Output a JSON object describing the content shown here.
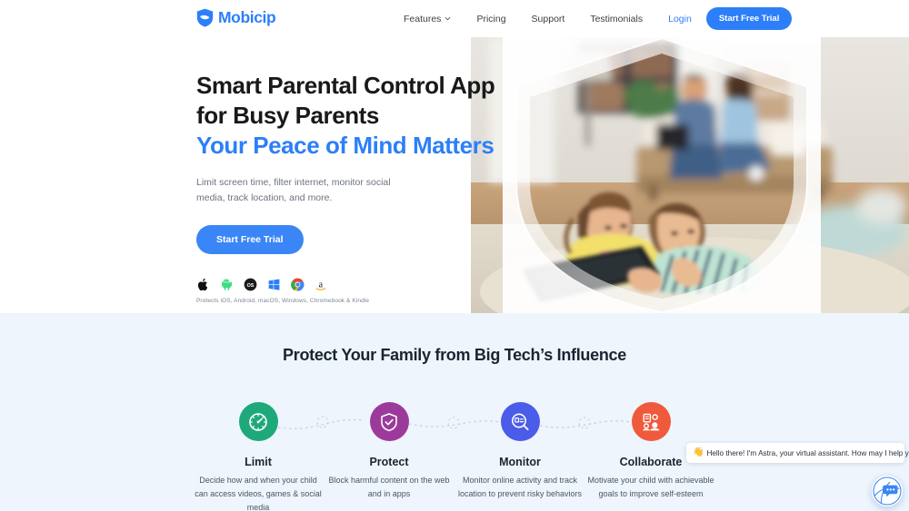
{
  "header": {
    "logo_text": "Mobicip",
    "logo_icon": "shield-logo-icon",
    "nav": [
      {
        "label": "Features",
        "has_caret": true,
        "icon": "chevron-down-icon"
      },
      {
        "label": "Pricing",
        "has_caret": false
      },
      {
        "label": "Support",
        "has_caret": false
      },
      {
        "label": "Testimonials",
        "has_caret": false
      }
    ],
    "login_label": "Login",
    "cta_label": "Start Free Trial",
    "accent_color": "#2D7FF9"
  },
  "hero": {
    "heading_line1": "Smart Parental Control App",
    "heading_line2": "for Busy Parents",
    "heading_accent": "Your Peace of Mind Matters",
    "subheading": "Limit screen time, filter internet, monitor social media, track location, and more.",
    "cta_label": "Start Free Trial",
    "cta_color": "#3b86f7",
    "platforms": [
      {
        "name": "apple-icon",
        "label": "Apple",
        "color": "#111111"
      },
      {
        "name": "android-icon",
        "label": "Android",
        "color": "#3DDC84"
      },
      {
        "name": "macos-icon",
        "label": "macOS",
        "color": "#1a1a1a"
      },
      {
        "name": "windows-icon",
        "label": "Windows",
        "color": "#2D7FF9"
      },
      {
        "name": "chrome-icon",
        "label": "Chromebook",
        "color": "#EA4335"
      },
      {
        "name": "amazon-icon",
        "label": "Kindle",
        "color": "#1a1a1a"
      }
    ],
    "platform_note": "Protects iOS, Android, macOS, Windows, Chromebook & Kindle",
    "image_alt": "Two children lying on carpet using a tablet while parents sit on a couch behind them, framed inside a translucent shield shape"
  },
  "features": {
    "title": "Protect Your Family from Big Tech’s Influence",
    "background_color": "#eef5fd",
    "items": [
      {
        "title": "Limit",
        "description": "Decide how and when your child can access videos, games & social media",
        "icon": "clock-icon",
        "color": "#1FA97A"
      },
      {
        "title": "Protect",
        "description": "Block harmful content on the web and in apps",
        "icon": "shield-check-icon",
        "color": "#9C3A9C"
      },
      {
        "title": "Monitor",
        "description": "Monitor online activity and track location to prevent risky behaviors",
        "icon": "magnifier-report-icon",
        "color": "#4A5CE8"
      },
      {
        "title": "Collaborate",
        "description": "Motivate your child with achievable goals to improve self-esteem",
        "icon": "collaborate-people-icon",
        "color": "#F05A3C"
      }
    ]
  },
  "chat": {
    "emoji": "👋",
    "message": "Hello there! I'm Astra, your virtual assistant. How may I help you?",
    "launcher_icon": "chat-bubble-icon"
  }
}
